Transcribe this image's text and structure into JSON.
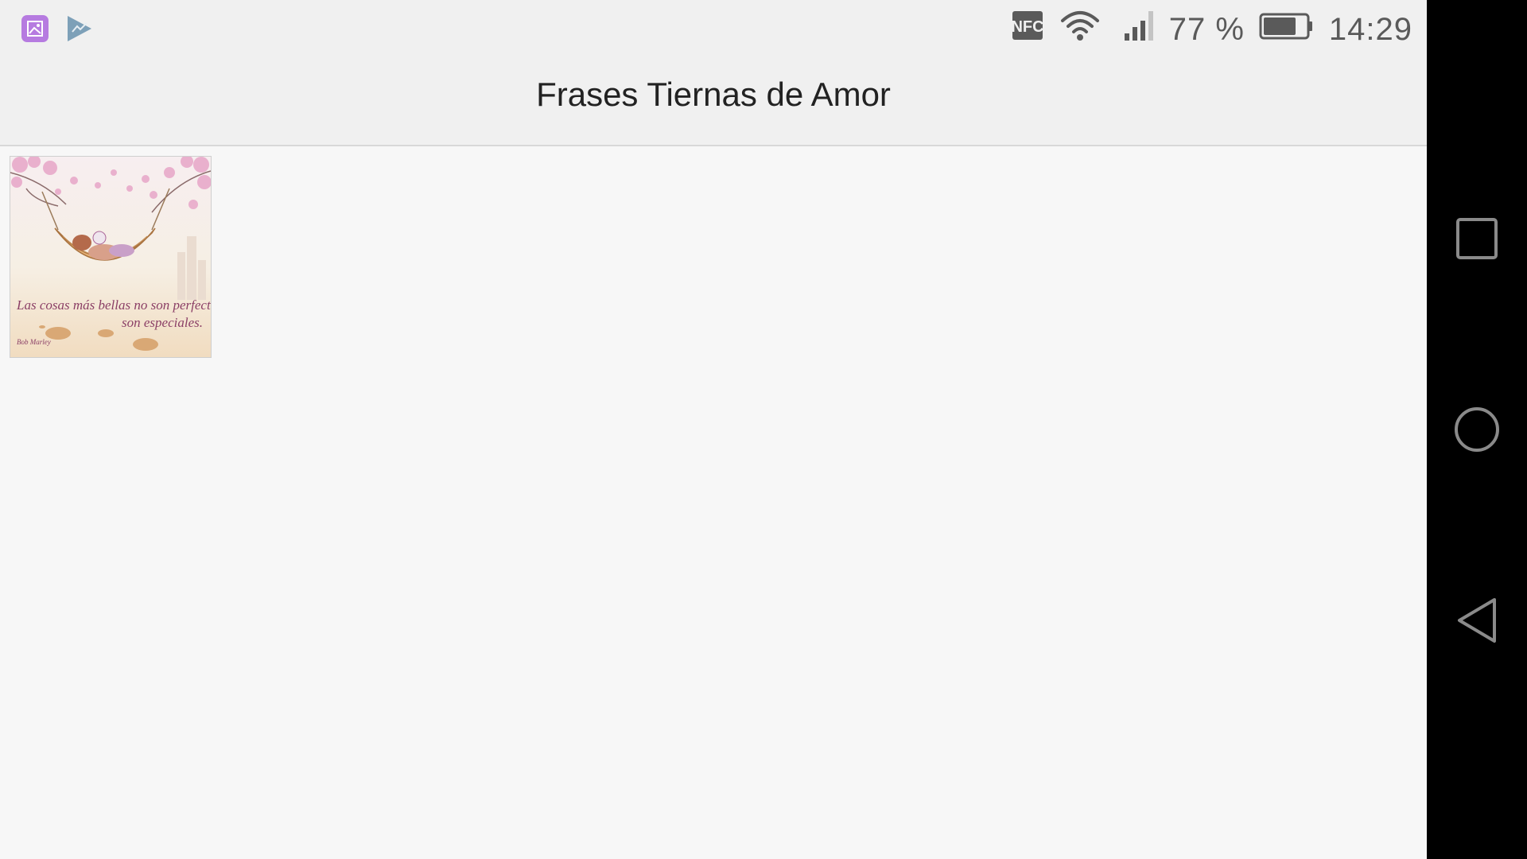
{
  "status_bar": {
    "left_icons": [
      "gallery-app-icon",
      "play-store-icon"
    ],
    "nfc_label": "NFC",
    "battery_percent_label": "77 %",
    "battery_level": 0.77,
    "time": "14:29"
  },
  "action_bar": {
    "title": "Frases Tiernas de Amor"
  },
  "gallery": {
    "items": [
      {
        "image_text": "Las cosas más bellas no son perfectas, son especiales.",
        "image_author": "Bob Marley"
      }
    ]
  },
  "nav_bar": {
    "buttons": [
      "recents-icon",
      "home-icon",
      "back-icon"
    ]
  },
  "colors": {
    "status_bar_bg": "#f0f0f0",
    "content_bg": "#f7f7f7",
    "nav_bar_bg": "#000000",
    "gallery_icon": "#b67be0"
  }
}
